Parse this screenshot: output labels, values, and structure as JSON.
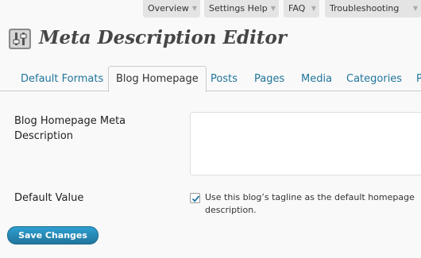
{
  "help_tabs": [
    {
      "label": "Overview"
    },
    {
      "label": "Settings Help"
    },
    {
      "label": "FAQ"
    },
    {
      "label": "Troubleshooting"
    }
  ],
  "header": {
    "title": "Meta Description Editor",
    "icon": "sliders-icon"
  },
  "tabs": [
    {
      "label": "Default Formats"
    },
    {
      "label": "Blog Homepage",
      "active": true
    },
    {
      "label": "Posts"
    },
    {
      "label": "Pages"
    },
    {
      "label": "Media"
    },
    {
      "label": "Categories"
    },
    {
      "label": "P"
    }
  ],
  "form": {
    "meta_label": "Blog Homepage Meta Description",
    "meta_value": "",
    "default_label": "Default Value",
    "checkbox_checked": true,
    "checkbox_label": "Use this blog’s tagline as the default homepage description."
  },
  "actions": {
    "save_label": "Save Changes"
  },
  "colors": {
    "link": "#21759b",
    "button": "#21759b",
    "background": "#f9f9f9"
  }
}
